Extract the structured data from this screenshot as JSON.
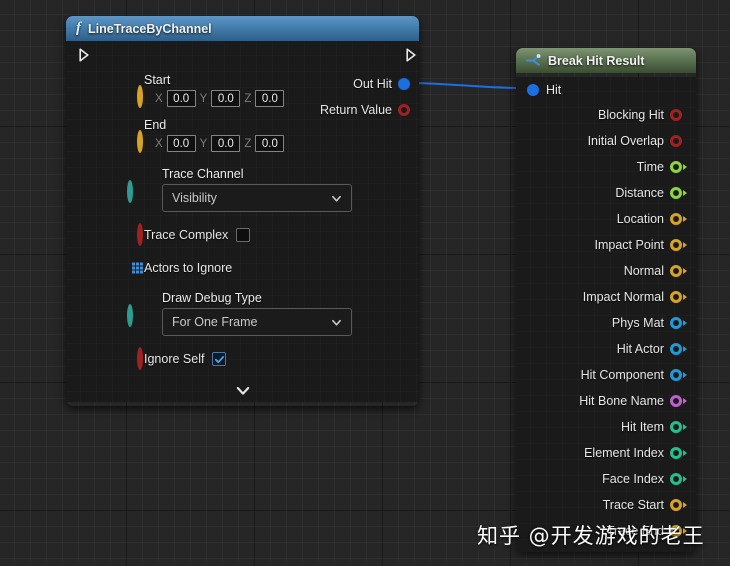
{
  "canvas": {
    "background_color": "#262626",
    "grid_line_color": "#333333"
  },
  "watermark": {
    "text": "知乎 @开发游戏的老王"
  },
  "nodes": {
    "line_trace": {
      "title": "LineTraceByChannel",
      "icon": "function-icon",
      "icon_glyph": "f",
      "title_color": "#437ead",
      "exec_in": "exec-in-pin",
      "exec_out": "exec-out-pin",
      "inputs": [
        {
          "label": "Start",
          "pin_color": "#d6a325",
          "type": "vector",
          "fields": [
            {
              "axis": "X",
              "value": "0.0"
            },
            {
              "axis": "Y",
              "value": "0.0"
            },
            {
              "axis": "Z",
              "value": "0.0"
            }
          ]
        },
        {
          "label": "End",
          "pin_color": "#d6a325",
          "type": "vector",
          "fields": [
            {
              "axis": "X",
              "value": "0.0"
            },
            {
              "axis": "Y",
              "value": "0.0"
            },
            {
              "axis": "Z",
              "value": "0.0"
            }
          ]
        },
        {
          "label": "Trace Channel",
          "pin_color": "#2e9c90",
          "type": "enum",
          "value": "Visibility"
        },
        {
          "label": "Trace Complex",
          "pin_color": "#a02121",
          "type": "boolean",
          "checked": false
        },
        {
          "label": "Actors to Ignore",
          "pin_color": "#3f8fd8",
          "type": "array"
        },
        {
          "label": "Draw Debug Type",
          "pin_color": "#2e9c90",
          "type": "enum",
          "value": "For One Frame"
        },
        {
          "label": "Ignore Self",
          "pin_color": "#a02121",
          "type": "boolean",
          "checked": true
        }
      ],
      "outputs": [
        {
          "label": "Out Hit",
          "pin_color": "#1c6fe0",
          "type": "struct",
          "connected": true
        },
        {
          "label": "Return Value",
          "pin_color": "#a02121",
          "type": "boolean",
          "connected": false
        }
      ],
      "expander": "expand-chevron"
    },
    "break_hit_result": {
      "title": "Break Hit Result",
      "icon": "break-struct-icon",
      "title_color": "#5d7452",
      "input": {
        "label": "Hit",
        "pin_color": "#1c6fe0",
        "type": "struct",
        "connected": true
      },
      "outputs": [
        {
          "label": "Blocking Hit",
          "pin_color": "#a02121",
          "type": "boolean"
        },
        {
          "label": "Initial Overlap",
          "pin_color": "#a02121",
          "type": "boolean"
        },
        {
          "label": "Time",
          "pin_color": "#8cd63a",
          "type": "float"
        },
        {
          "label": "Distance",
          "pin_color": "#8cd63a",
          "type": "float"
        },
        {
          "label": "Location",
          "pin_color": "#d6a325",
          "type": "vector"
        },
        {
          "label": "Impact Point",
          "pin_color": "#d6a325",
          "type": "vector"
        },
        {
          "label": "Normal",
          "pin_color": "#d6a325",
          "type": "vector"
        },
        {
          "label": "Impact Normal",
          "pin_color": "#d6a325",
          "type": "vector"
        },
        {
          "label": "Phys Mat",
          "pin_color": "#1f9ad6",
          "type": "object"
        },
        {
          "label": "Hit Actor",
          "pin_color": "#1f9ad6",
          "type": "object"
        },
        {
          "label": "Hit Component",
          "pin_color": "#1f9ad6",
          "type": "object"
        },
        {
          "label": "Hit Bone Name",
          "pin_color": "#c060d0",
          "type": "name"
        },
        {
          "label": "Hit Item",
          "pin_color": "#22c08a",
          "type": "integer"
        },
        {
          "label": "Element Index",
          "pin_color": "#22c08a",
          "type": "integer"
        },
        {
          "label": "Face Index",
          "pin_color": "#22c08a",
          "type": "integer"
        },
        {
          "label": "Trace Start",
          "pin_color": "#d6a325",
          "type": "vector"
        },
        {
          "label": "Trace End",
          "pin_color": "#d6a325",
          "type": "vector"
        }
      ]
    }
  },
  "connection": {
    "from": "Out Hit",
    "to": "Hit",
    "color": "#1c6fe0"
  }
}
